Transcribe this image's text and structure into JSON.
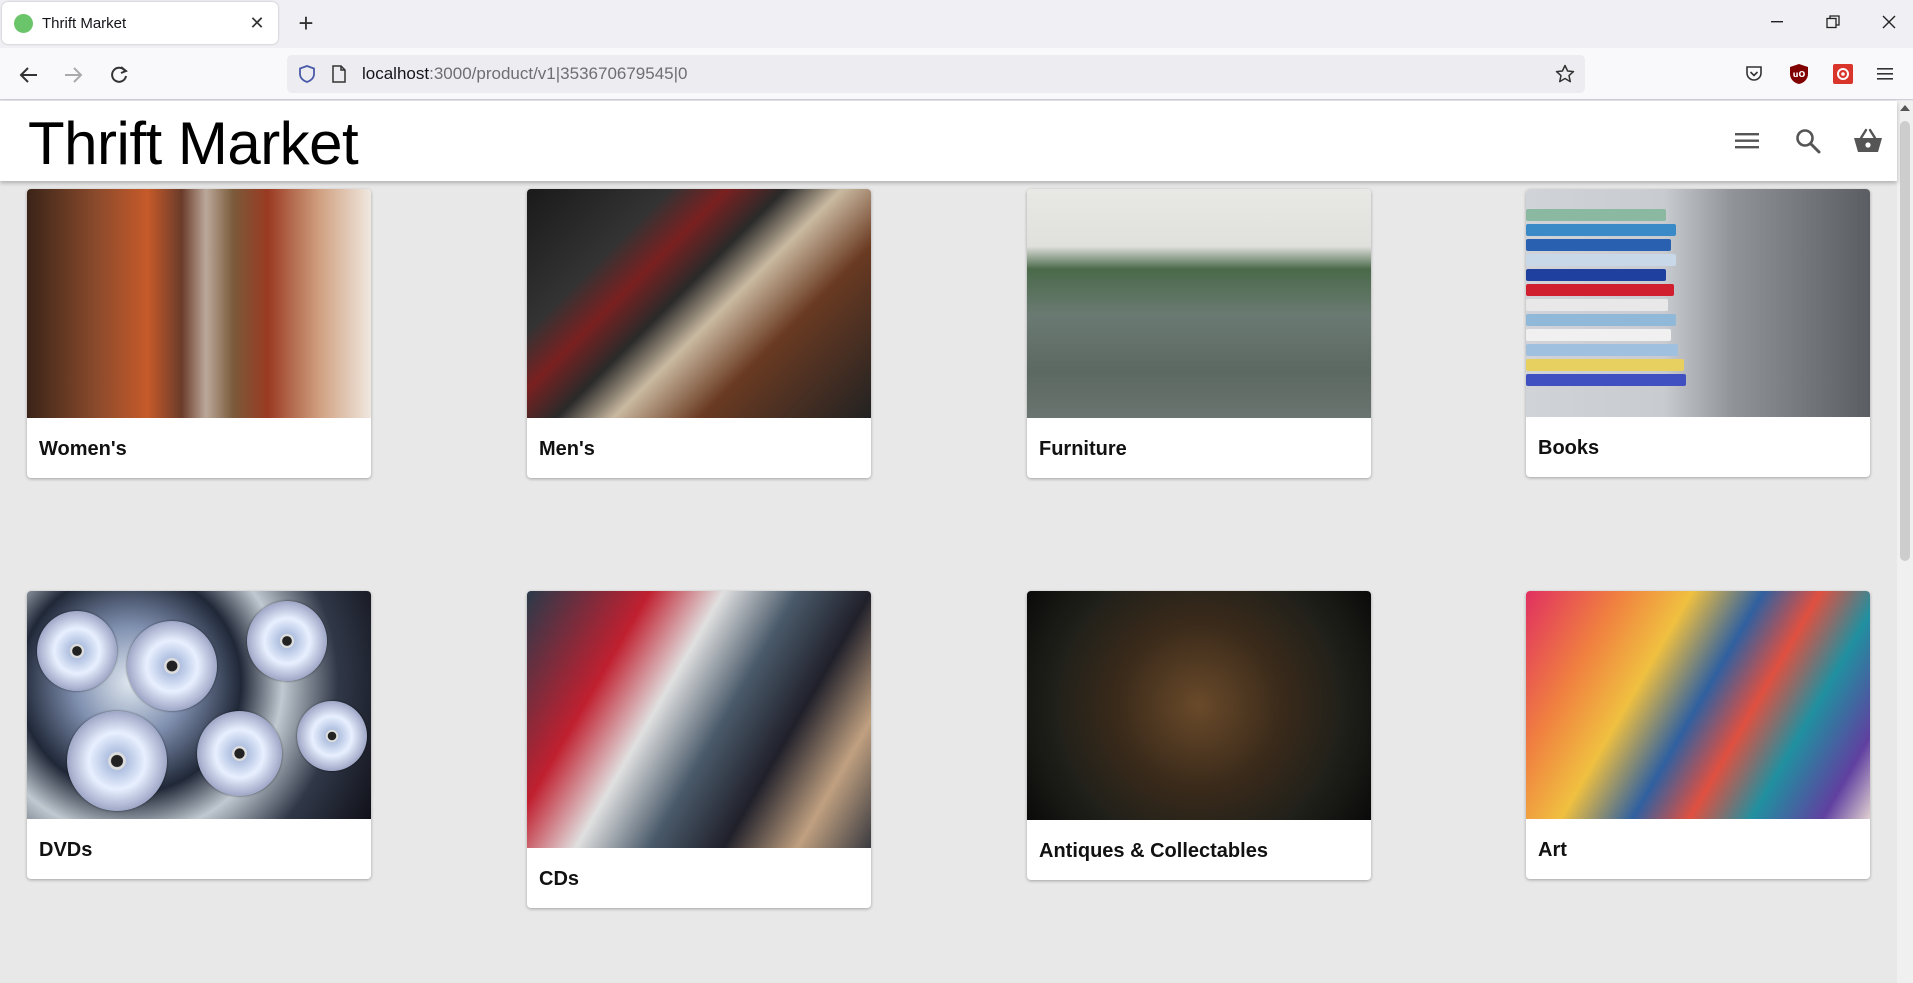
{
  "browser": {
    "tab_title": "Thrift Market",
    "url_host": "localhost",
    "url_rest": ":3000/product/v1|353670679545|0"
  },
  "app": {
    "title": "Thrift Market"
  },
  "icons": {
    "menu": "menu-icon",
    "search": "search-icon",
    "basket": "basket-icon"
  },
  "categories": [
    {
      "label": "Women's"
    },
    {
      "label": "Men's"
    },
    {
      "label": "Furniture"
    },
    {
      "label": "Books"
    },
    {
      "label": "DVDs"
    },
    {
      "label": "CDs"
    },
    {
      "label": "Antiques & Collectables"
    },
    {
      "label": "Art"
    }
  ]
}
